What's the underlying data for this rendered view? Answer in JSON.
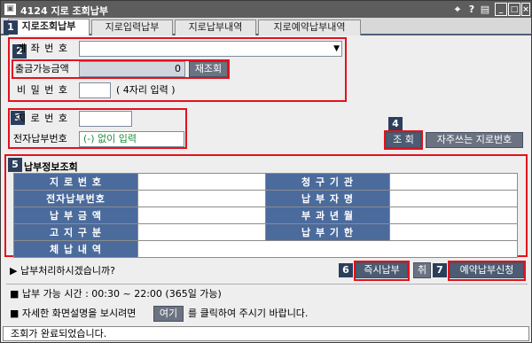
{
  "titlebar": {
    "app_icon": "app-icon",
    "title": "4124 지로 조회납부",
    "pin_icon": "pin-icon",
    "help_label": "?",
    "menu_label": "▤",
    "minimize_label": "_",
    "maximize_label": "□",
    "close_label": "×"
  },
  "tabs": [
    {
      "label": "지로조회납부",
      "active": true
    },
    {
      "label": "지로입력납부",
      "active": false
    },
    {
      "label": "지로납부내역",
      "active": false
    },
    {
      "label": "지로예약납부내역",
      "active": false
    }
  ],
  "badges": [
    "1",
    "2",
    "3",
    "4",
    "5",
    "6",
    "7"
  ],
  "account": {
    "account_label": "계 좌 번 호",
    "balance_label": "출금가능금액",
    "balance_value": "0",
    "reinquire_label": "재조회",
    "password_label": "비 밀 번 호",
    "password_hint": "( 4자리 입력 )"
  },
  "giro": {
    "giro_label": "지 로 번 호",
    "epay_label": "전자납부번호",
    "epay_placeholder": "(-) 없이 입력",
    "inquire_label": "조 회",
    "favorites_label": "자주쓰는 지로번호"
  },
  "info": {
    "section_title": "납부정보조회",
    "rows": [
      [
        "지 로 번 호",
        "청 구 기 관"
      ],
      [
        "전자납부번호",
        "납 부 자 명"
      ],
      [
        "납 부 금 액",
        "부 과 년 월"
      ],
      [
        "고 지 구 분",
        "납 부 기 한"
      ],
      [
        "체 납 내 역",
        ""
      ]
    ]
  },
  "actions": {
    "question": "▶ 납부처리하시겠습니까?",
    "pay_now_label": "즉시납부",
    "cancel_label": "취",
    "reserve_label": "예약납부신청"
  },
  "notes": {
    "hours": "■ 납부 가능 시간 : 00:30 ~ 22:00 (365일 가능)",
    "help_prefix": "■ 자세한 화면설명을 보시려면",
    "help_link": "여기",
    "help_suffix": "를 클릭하여 주시기 바랍니다."
  },
  "status": "조회가 완료되었습니다."
}
